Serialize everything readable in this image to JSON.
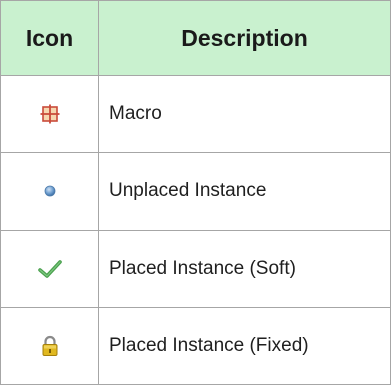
{
  "table": {
    "headers": {
      "icon": "Icon",
      "description": "Description"
    },
    "rows": [
      {
        "icon": "macro-grid-icon",
        "description": "Macro"
      },
      {
        "icon": "unplaced-instance-dot-icon",
        "description": "Unplaced Instance"
      },
      {
        "icon": "checkmark-icon",
        "description": "Placed Instance (Soft)"
      },
      {
        "icon": "padlock-icon",
        "description": "Placed Instance (Fixed)"
      }
    ]
  },
  "colors": {
    "header_background": "#c9f1cf",
    "border": "#a6a6a6",
    "macro_icon": "#c94a3a",
    "unplaced_dot": "#5b8fc4",
    "checkmark": "#4aa04e",
    "padlock": "#e0b820"
  }
}
